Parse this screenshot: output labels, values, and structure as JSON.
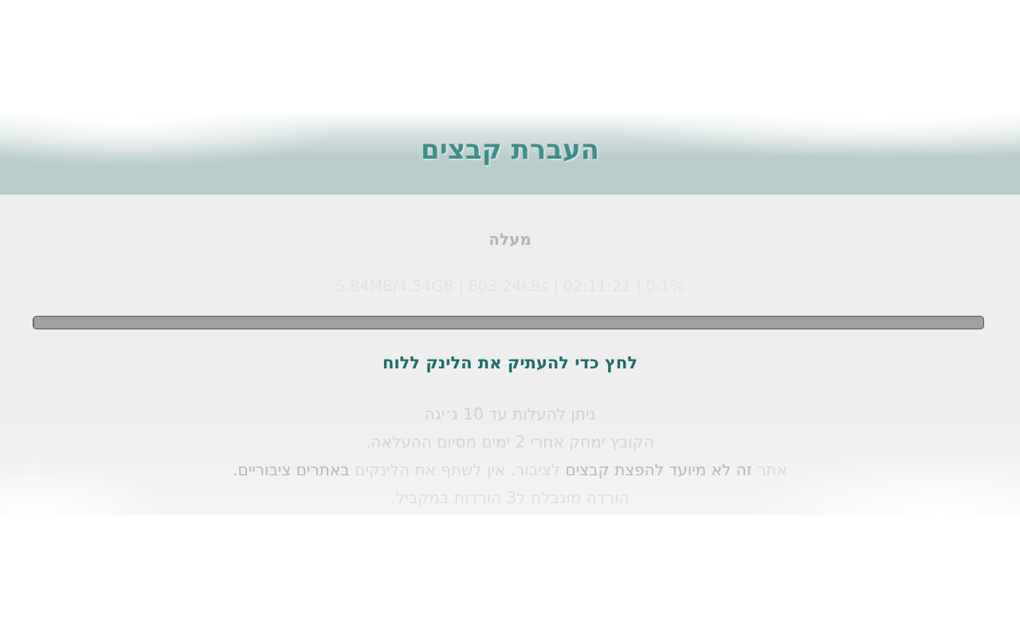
{
  "header": {
    "title": "העברת קבצים"
  },
  "upload": {
    "status_label": "מעלה",
    "stats_text": "5.84MB/4.54GB | 603.24kBs | 02:11:21 | 0.1%",
    "progress_percent": 0.1,
    "copy_link_label": "לחץ כדי להעתיק את הלינק ללוח"
  },
  "notes": {
    "line1": "ניתן להעלות עד 10 ג׳יגה",
    "line2": "הקובץ ימחק אחרי 2 ימים מסיום ההעלאה.",
    "line3_part1": "אתר",
    "line3_part2": "זה לא מיועד להפצת קבצים",
    "line3_part3": "לציבור. אין לשתף את הלינקים",
    "line3_part4": "באתרים ציבוריים.",
    "line4": "הורדה מוגבלת ל3 הורדות במקביל."
  },
  "colors": {
    "accent": "#2f8c88",
    "header_band": "#b9cccb",
    "content_bg": "#eeeeee"
  }
}
